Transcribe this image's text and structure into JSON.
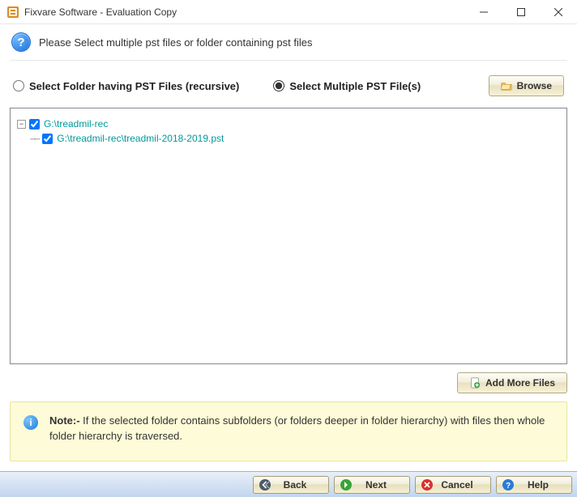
{
  "window": {
    "title": "Fixvare Software - Evaluation Copy"
  },
  "instruction": "Please Select multiple pst files or folder containing pst files",
  "options": {
    "folder_label": "Select Folder having PST Files (recursive)",
    "multi_label": "Select Multiple PST File(s)",
    "selected": "multi"
  },
  "buttons": {
    "browse": "Browse",
    "add_more": "Add More Files",
    "back": "Back",
    "next": "Next",
    "cancel": "Cancel",
    "help": "Help"
  },
  "tree": {
    "root": {
      "label": "G:\\treadmil-rec",
      "checked": true,
      "expanded": true,
      "children": [
        {
          "label": "G:\\treadmil-rec\\treadmil-2018-2019.pst",
          "checked": true
        }
      ]
    }
  },
  "note": {
    "label": "Note:-",
    "text": "If the selected folder contains subfolders (or folders deeper in folder hierarchy) with files then whole folder hierarchy is traversed."
  }
}
